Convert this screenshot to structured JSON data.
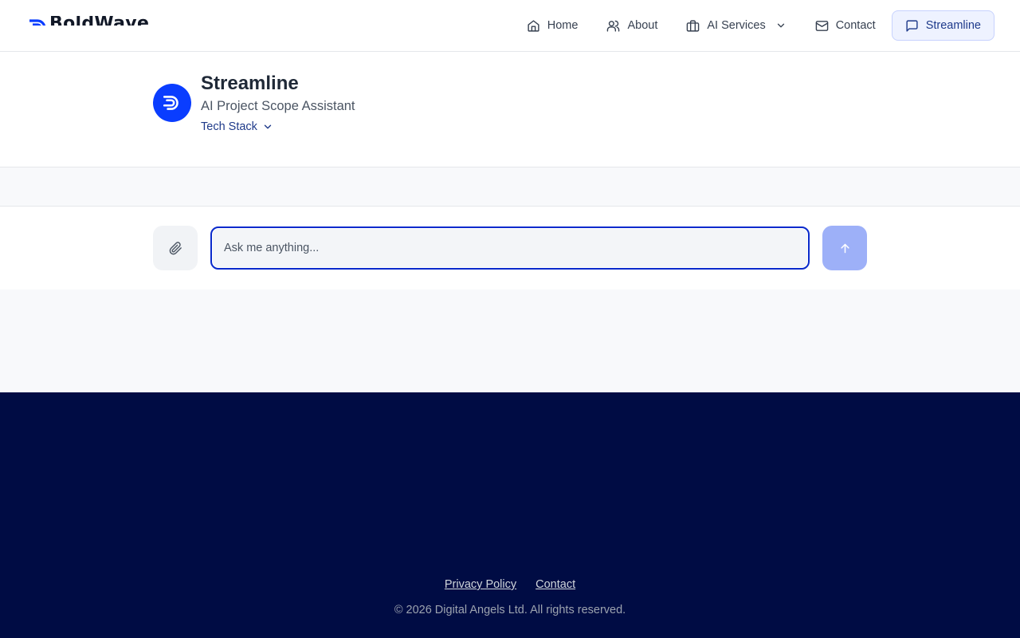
{
  "brand": {
    "name": "BoldWave",
    "accent": "#0a3dff"
  },
  "nav": {
    "items": [
      {
        "label": "Home",
        "icon": "home-icon"
      },
      {
        "label": "About",
        "icon": "users-icon"
      },
      {
        "label": "AI Services",
        "icon": "briefcase-icon",
        "dropdown": true
      },
      {
        "label": "Contact",
        "icon": "mail-icon"
      },
      {
        "label": "Streamline",
        "icon": "chat-icon",
        "active": true
      }
    ]
  },
  "assistant": {
    "name": "Streamline",
    "subtitle": "AI Project Scope Assistant",
    "tech_stack_label": "Tech Stack"
  },
  "composer": {
    "placeholder": "Ask me anything...",
    "value": ""
  },
  "footer": {
    "links": [
      "Privacy Policy",
      "Contact"
    ],
    "copyright": "© 2026 Digital Angels Ltd. All rights reserved.",
    "background": "#000c44"
  }
}
